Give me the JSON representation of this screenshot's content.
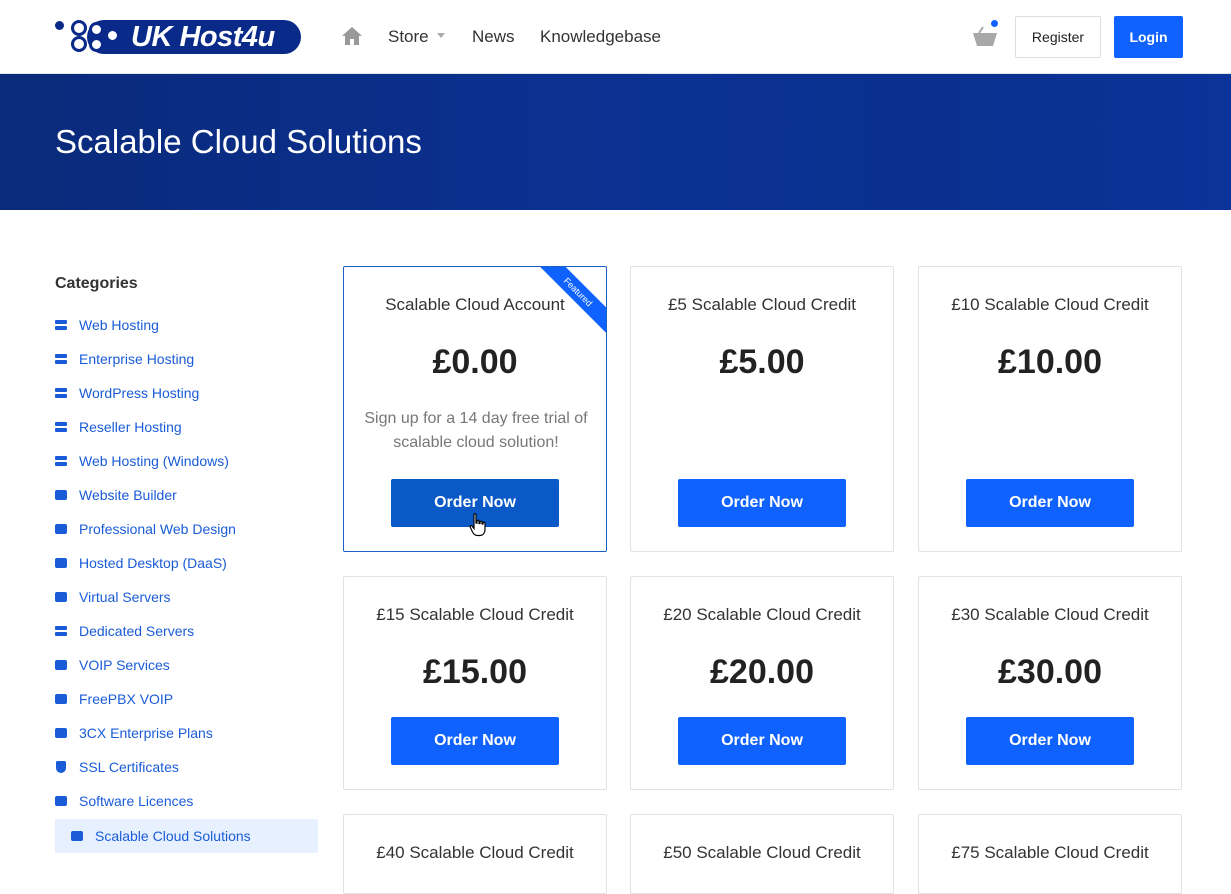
{
  "brand": {
    "name": "UK Host4u"
  },
  "nav": {
    "home_icon": "home-icon",
    "items": [
      {
        "label": "Store",
        "has_dropdown": true
      },
      {
        "label": "News"
      },
      {
        "label": "Knowledgebase"
      }
    ],
    "cart_icon": "basket-icon",
    "register_label": "Register",
    "login_label": "Login"
  },
  "banner": {
    "title": "Scalable Cloud Solutions"
  },
  "sidebar": {
    "title": "Categories",
    "items": [
      {
        "label": "Web Hosting",
        "icon": "server-icon"
      },
      {
        "label": "Enterprise Hosting",
        "icon": "server-icon"
      },
      {
        "label": "WordPress Hosting",
        "icon": "server-icon"
      },
      {
        "label": "Reseller Hosting",
        "icon": "server-icon"
      },
      {
        "label": "Web Hosting (Windows)",
        "icon": "server-icon"
      },
      {
        "label": "Website Builder",
        "icon": "box-icon"
      },
      {
        "label": "Professional Web Design",
        "icon": "box-icon"
      },
      {
        "label": "Hosted Desktop (DaaS)",
        "icon": "box-icon"
      },
      {
        "label": "Virtual Servers",
        "icon": "box-icon"
      },
      {
        "label": "Dedicated Servers",
        "icon": "server-icon"
      },
      {
        "label": "VOIP Services",
        "icon": "box-icon"
      },
      {
        "label": "FreePBX VOIP",
        "icon": "box-icon"
      },
      {
        "label": "3CX Enterprise Plans",
        "icon": "box-icon"
      },
      {
        "label": "SSL Certificates",
        "icon": "shield-icon"
      },
      {
        "label": "Software Licences",
        "icon": "box-icon"
      },
      {
        "label": "Scalable Cloud Solutions",
        "icon": "box-icon",
        "active": true
      }
    ]
  },
  "products": [
    {
      "name": "Scalable Cloud Account",
      "price": "£0.00",
      "description": "Sign up for a 14 day free trial of scalable cloud solution!",
      "button": "Order Now",
      "badge": "Featured"
    },
    {
      "name": "£5 Scalable Cloud Credit",
      "price": "£5.00",
      "button": "Order Now"
    },
    {
      "name": "£10 Scalable Cloud Credit",
      "price": "£10.00",
      "button": "Order Now"
    },
    {
      "name": "£15 Scalable Cloud Credit",
      "price": "£15.00",
      "button": "Order Now"
    },
    {
      "name": "£20 Scalable Cloud Credit",
      "price": "£20.00",
      "button": "Order Now"
    },
    {
      "name": "£30 Scalable Cloud Credit",
      "price": "£30.00",
      "button": "Order Now"
    },
    {
      "name": "£40 Scalable Cloud Credit"
    },
    {
      "name": "£50 Scalable Cloud Credit"
    },
    {
      "name": "£75 Scalable Cloud Credit"
    }
  ],
  "colors": {
    "accent": "#1062fe",
    "banner": "#0a2a7a",
    "link": "#1a5cd8"
  }
}
